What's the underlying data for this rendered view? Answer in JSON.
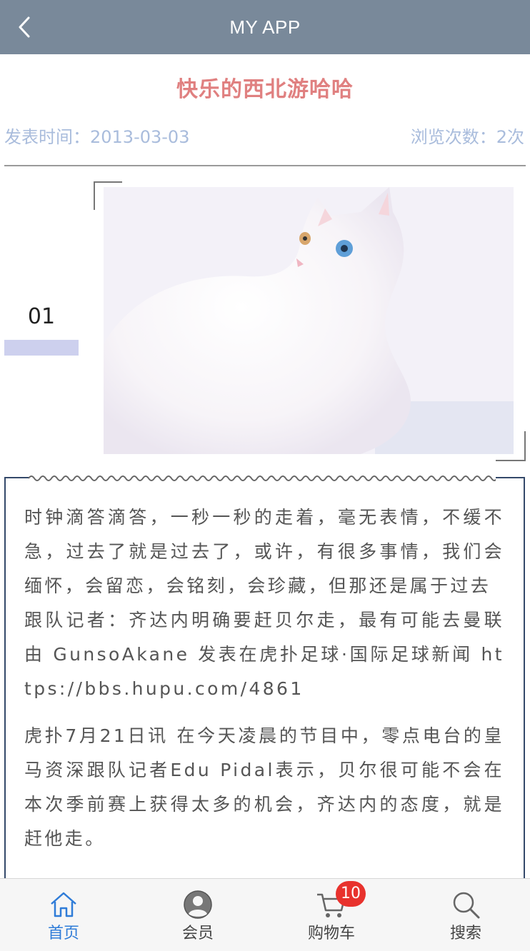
{
  "header": {
    "title": "MY APP",
    "back_icon": "chevron-left-icon"
  },
  "article": {
    "title": "快乐的西北游哈哈",
    "publish_label": "发表时间：2013-03-03",
    "views_label": "浏览次数：2次",
    "section_number": "01",
    "paragraphs": [
      "时钟滴答滴答，一秒一秒的走着，毫无表情，不缓不急，过去了就是过去了，或许，有很多事情，我们会缅怀，会留恋，会铭刻，会珍藏，但那还是属于过去",
      "跟队记者：齐达内明确要赶贝尔走，最有可能去曼联 由 GunsoAkane 发表在虎扑足球·国际足球新闻 https://bbs.hupu.com/4861",
      "虎扑7月21日讯 在今天凌晨的节目中，零点电台的皇马资深跟队记者Edu Pidal表示，贝尔很可能不会在本次季前赛上获得太多的机会，齐达内的态度，就是赶他走。"
    ]
  },
  "tabbar": {
    "items": [
      {
        "label": "首页",
        "icon": "home-icon",
        "active": true
      },
      {
        "label": "会员",
        "icon": "user-icon",
        "active": false
      },
      {
        "label": "购物车",
        "icon": "cart-icon",
        "active": false,
        "badge": "10"
      },
      {
        "label": "搜索",
        "icon": "search-icon",
        "active": false
      }
    ]
  },
  "colors": {
    "header_bg": "#79899a",
    "title": "#e08080",
    "meta": "#a9bcdc",
    "active_tab": "#2f7cd8",
    "badge": "#e8322d",
    "frame": "#34496a"
  }
}
